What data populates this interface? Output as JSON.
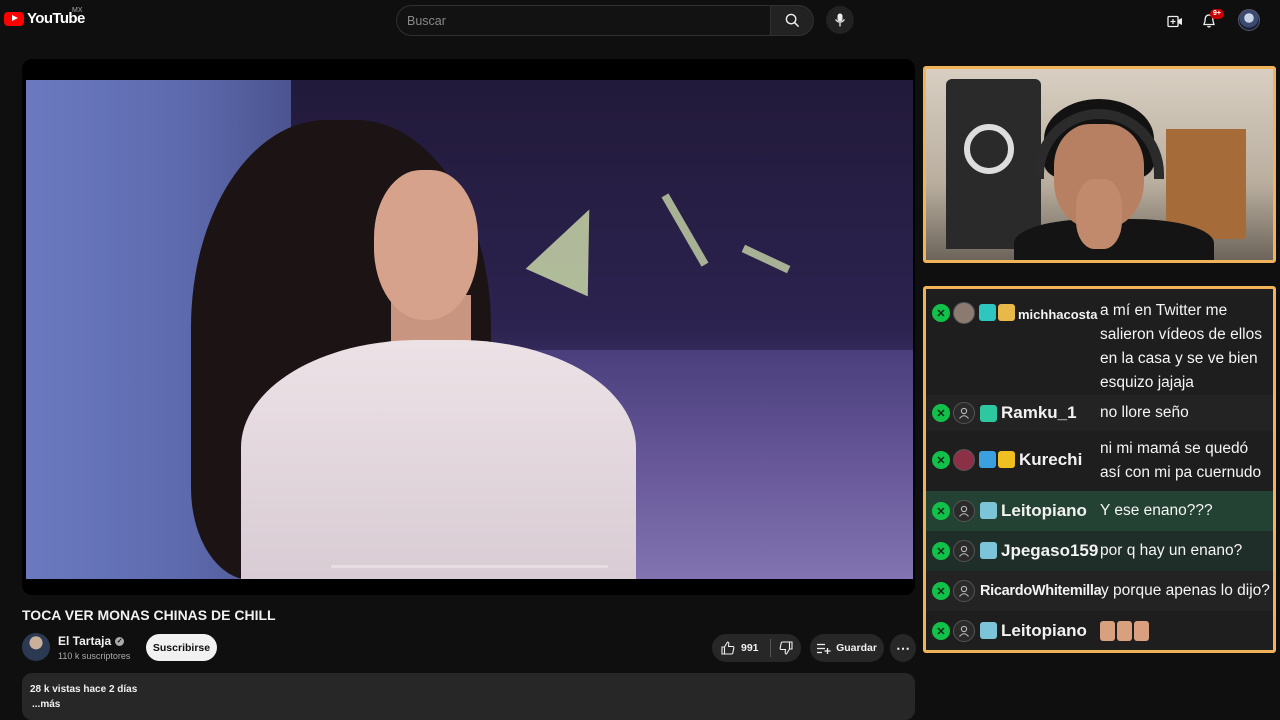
{
  "header": {
    "logo_text": "YouTube",
    "region": "MX",
    "search_placeholder": "Buscar",
    "notifications_count": "9+"
  },
  "chat": {
    "messages": [
      {
        "user": "michhacosta",
        "text": "a mí en Twitter me salieron vídeos de ellos en la casa y se ve bien esquizo jajaja"
      },
      {
        "user": "Ramku_1",
        "text": "no llore seño"
      },
      {
        "user": "Kurechi",
        "text": "ni mi mamá se quedó así con mi pa cuernudo"
      },
      {
        "user": "Leitopiano",
        "text": "Y ese enano???"
      },
      {
        "user": "Jpegaso159",
        "text": "por q hay un enano?"
      },
      {
        "user": "RicardoWhitemilla",
        "text": "y porque apenas lo dijo?"
      },
      {
        "user": "Leitopiano",
        "text": ""
      }
    ]
  },
  "video": {
    "title": "TOCA VER MONAS CHINAS DE CHILL",
    "channel_name": "El Tartaja",
    "subscribers": "110 k suscriptores",
    "subscribe_label": "Suscribirse",
    "likes": "991",
    "save_label": "Guardar",
    "views_date": "28 k vistas  hace 2 días",
    "more_label": "...más"
  },
  "colors": {
    "overlay_border": "#f0b35a",
    "mod_badge": "#12c14a",
    "brand_red": "#ff0000"
  }
}
